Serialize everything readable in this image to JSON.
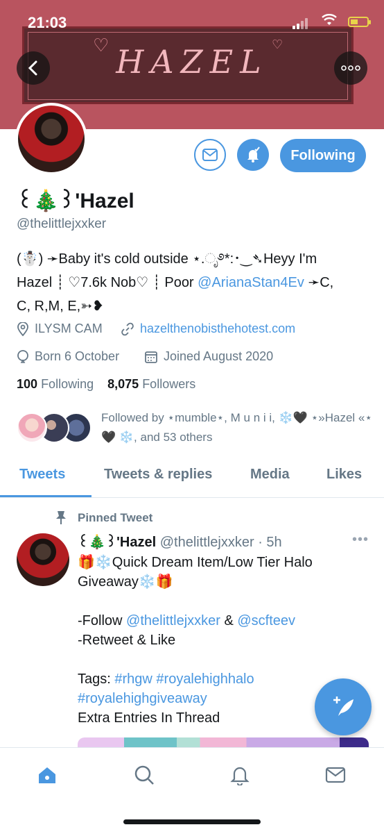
{
  "status": {
    "time": "21:03"
  },
  "banner": {
    "title": "HAZEL"
  },
  "profile": {
    "name": "꒰🎄꒱'Hazel",
    "handle": "@thelittlejxxker",
    "follow_label": "Following",
    "bio_lines": [
      "(☃️) ➛Baby it's cold outside ⋆.ೃ࿔*:･‿➴Heyy I'm",
      "Hazel ┊ ♡7.6k Nob♡ ┊ Poor ",
      "C, R,M, E,➳❥"
    ],
    "bio_mention": "@ArianaStan4Ev",
    "bio_after_mention": " ➛C,",
    "location": "ILYSM CAM",
    "website": "hazelthenobisthehotest.com",
    "birthday": "Born 6 October",
    "joined": "Joined August 2020",
    "following_count": "100",
    "following_label": "Following",
    "followers_count": "8,075",
    "followers_label": "Followers",
    "followed_by": "Followed by ⋆mumble⋆, M u n i i, ❄️🖤 ⋆»Hazel «⋆🖤 ❄️, and 53 others"
  },
  "tabs": [
    "Tweets",
    "Tweets & replies",
    "Media",
    "Likes"
  ],
  "tweet": {
    "pinned_label": "Pinned Tweet",
    "name": "꒰🎄꒱'Hazel",
    "handle": "@thelittlejxxker",
    "time": "· 5h",
    "line1": "🎁❄️Quick Dream Item/Low Tier Halo Giveaway❄️🎁",
    "follow_prefix": "-Follow ",
    "mention1": "@thelittlejxxker",
    "amp": " & ",
    "mention2": "@scfteev",
    "retweet_line": "-Retweet & Like",
    "tags_prefix": "Tags: ",
    "tag1": "#rhgw",
    "tag2": "#royalehighhalo",
    "tag3": "#royalehighgiveaway",
    "extra": "Extra Entries In Thread"
  },
  "colors": {
    "accent": "#4a97e0",
    "banner": "#b9545f"
  }
}
